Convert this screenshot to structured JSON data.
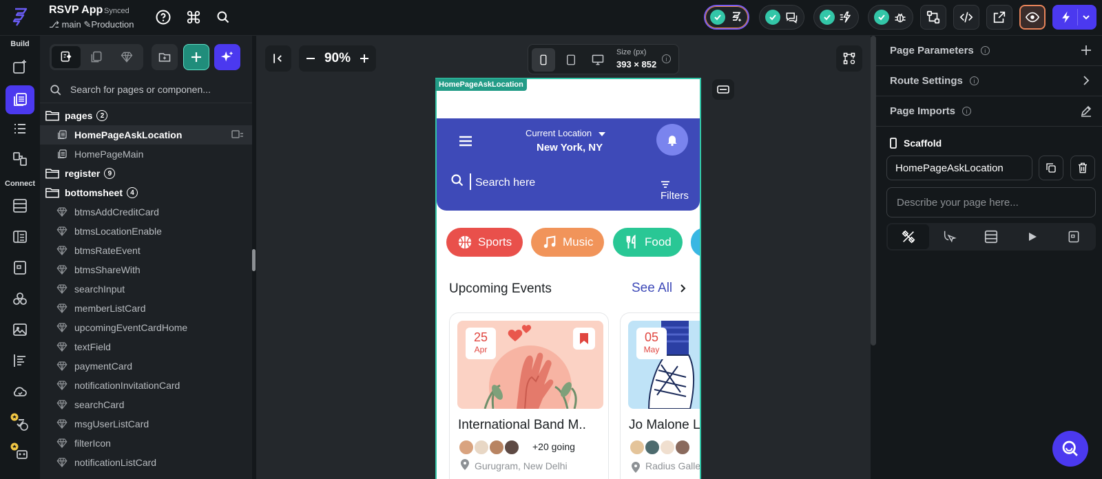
{
  "topbar": {
    "app_title": "RSVP App",
    "sync_status": "Synced",
    "branch": "main",
    "environment": "Production"
  },
  "rail": {
    "build_label": "Build",
    "connect_label": "Connect"
  },
  "left_panel": {
    "search_placeholder": "Search for pages or componen...",
    "tree": [
      {
        "label": "pages",
        "count": "2",
        "type": "folder"
      },
      {
        "label": "HomePageAskLocation",
        "type": "page",
        "selected": true
      },
      {
        "label": "HomePageMain",
        "type": "page"
      },
      {
        "label": "register",
        "count": "9",
        "type": "folder"
      },
      {
        "label": "bottomsheet",
        "count": "4",
        "type": "folder"
      },
      {
        "label": "btmsAddCreditCard",
        "type": "component"
      },
      {
        "label": "btmsLocationEnable",
        "type": "component"
      },
      {
        "label": "btmsRateEvent",
        "type": "component"
      },
      {
        "label": "btmsShareWith",
        "type": "component"
      },
      {
        "label": "searchInput",
        "type": "component"
      },
      {
        "label": "memberListCard",
        "type": "component"
      },
      {
        "label": "upcomingEventCardHome",
        "type": "component"
      },
      {
        "label": "textField",
        "type": "component"
      },
      {
        "label": "paymentCard",
        "type": "component"
      },
      {
        "label": "notificationInvitationCard",
        "type": "component"
      },
      {
        "label": "searchCard",
        "type": "component"
      },
      {
        "label": "msgUserListCard",
        "type": "component"
      },
      {
        "label": "filterIcon",
        "type": "component"
      },
      {
        "label": "notificationListCard",
        "type": "component"
      }
    ]
  },
  "canvas": {
    "zoom_label": "90%",
    "size_label": "Size (px)",
    "size_value": "393 × 852",
    "page_tag": "HomePageAskLocation"
  },
  "phone": {
    "location_label": "Current Location",
    "location_value": "New York, NY",
    "search_placeholder": "Search here",
    "filters_label": "Filters",
    "chips": [
      {
        "label": "Sports",
        "color": "#e9504b"
      },
      {
        "label": "Music",
        "color": "#f1945a"
      },
      {
        "label": "Food",
        "color": "#29c795"
      }
    ],
    "section_title": "Upcoming Events",
    "see_all": "See All",
    "events": [
      {
        "day": "25",
        "month": "Apr",
        "title": "International Band M..",
        "going": "+20 going",
        "place": "Gurugram, New Delhi"
      },
      {
        "day": "05",
        "month": "May",
        "title": "Jo Malone Lo",
        "going": "",
        "place": "Radius Galle"
      }
    ]
  },
  "right_panel": {
    "page_parameters": "Page Parameters",
    "route_settings": "Route Settings",
    "page_imports": "Page Imports",
    "scaffold_label": "Scaffold",
    "page_name": "HomePageAskLocation",
    "description_placeholder": "Describe your page here..."
  },
  "colors": {
    "accent": "#4b39ef",
    "teal": "#33c6a8",
    "phone_header": "#3e4ab8"
  }
}
